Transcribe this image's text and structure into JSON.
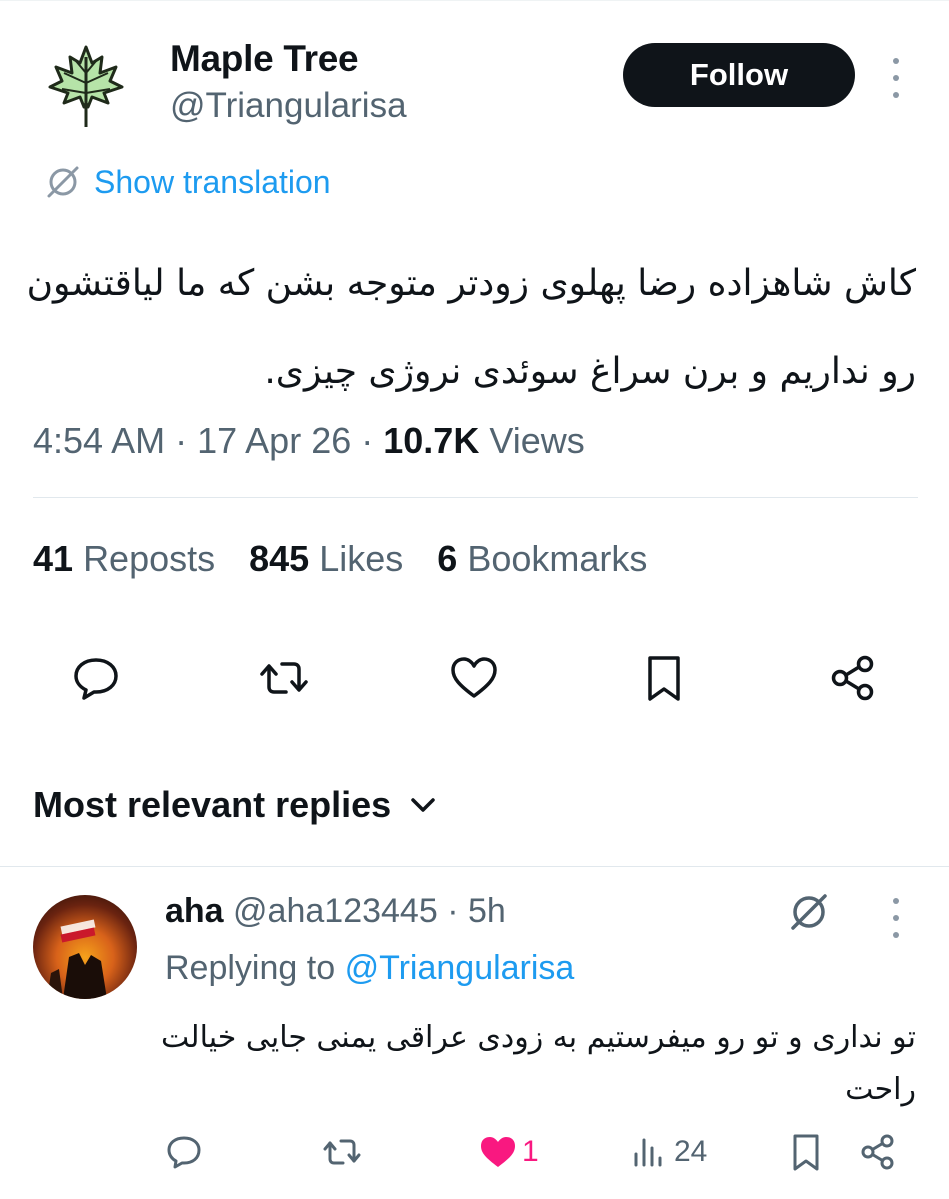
{
  "tweet": {
    "author_name": "Maple Tree",
    "author_handle": "@Triangularisa",
    "follow_label": "Follow",
    "show_translation_label": "Show translation",
    "text": "کاش شاهزاده رضا پهلوی زودتر متوجه بشن که ما لیاقتشون رو نداریم و برن سراغ سوئدی نروژی چیزی.",
    "time": "4:54 AM",
    "date": "17 Apr 26",
    "views_count": "10.7K",
    "views_label": "Views",
    "reposts_count": "41",
    "reposts_label": "Reposts",
    "likes_count": "845",
    "likes_label": "Likes",
    "bookmarks_count": "6",
    "bookmarks_label": "Bookmarks"
  },
  "replies": {
    "sort_label": "Most relevant replies"
  },
  "reply": {
    "name": "aha",
    "handle": "@aha123445",
    "time": "5h",
    "replying_to_label": "Replying to",
    "replying_to_handle": "@Triangularisa",
    "text": "تو نداری و تو رو میفرستیم به زودی عراقی یمنی جایی خیالت راحت",
    "likes_count": "1",
    "views_count": "24"
  },
  "icons": {
    "avatar": "maple-leaf-icon",
    "translate": "translate-icon",
    "reply": "reply-icon",
    "repost": "repost-icon",
    "like": "heart-icon",
    "bookmark": "bookmark-icon",
    "share": "share-icon",
    "views": "views-icon",
    "sort": "chevron-down-icon",
    "more": "more-icon"
  },
  "colors": {
    "accent": "#1d9bf0",
    "text_primary": "#0f1419",
    "text_secondary": "#536471",
    "like_active": "#f91880",
    "follow_bg": "#0f1419"
  }
}
